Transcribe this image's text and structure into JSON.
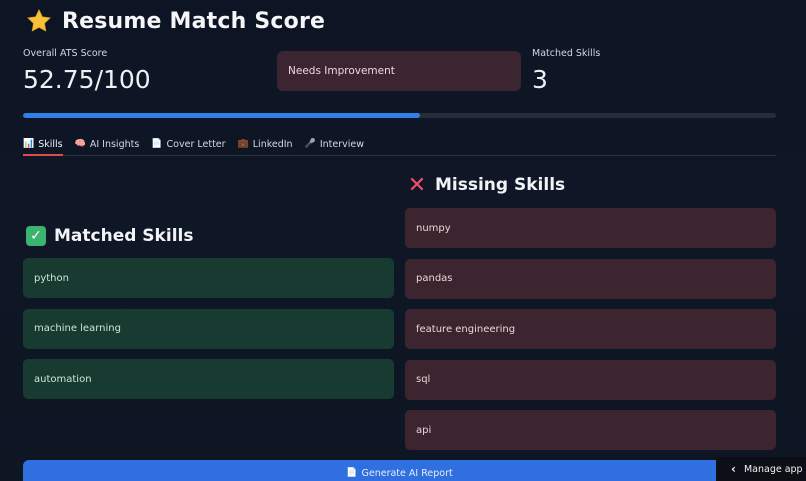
{
  "header": {
    "title": "Resume Match Score",
    "icon": "star-icon"
  },
  "metrics": {
    "ats_label": "Overall ATS Score",
    "ats_value": "52.75/100",
    "ats_progress_percent": 52.75,
    "status": "Needs Improvement",
    "matched_label": "Matched Skills",
    "matched_value": "3"
  },
  "tabs": [
    {
      "label": "Skills",
      "icon": "chart-icon",
      "active": true
    },
    {
      "label": "AI Insights",
      "icon": "brain-icon",
      "active": false
    },
    {
      "label": "Cover Letter",
      "icon": "document-icon",
      "active": false
    },
    {
      "label": "LinkedIn",
      "icon": "briefcase-icon",
      "active": false
    },
    {
      "label": "Interview",
      "icon": "microphone-icon",
      "active": false
    }
  ],
  "matched": {
    "title": "Matched Skills",
    "items": [
      "python",
      "machine learning",
      "automation"
    ]
  },
  "missing": {
    "title": "Missing Skills",
    "items": [
      "numpy",
      "pandas",
      "feature engineering",
      "sql",
      "api"
    ]
  },
  "actions": {
    "generate_label": "Generate AI Report",
    "manage_app_label": "Manage app"
  },
  "colors": {
    "accent": "#2f80e6",
    "matched_bg": "#173b30",
    "missing_bg": "#3d252f",
    "active_tab": "#e24b4b"
  }
}
